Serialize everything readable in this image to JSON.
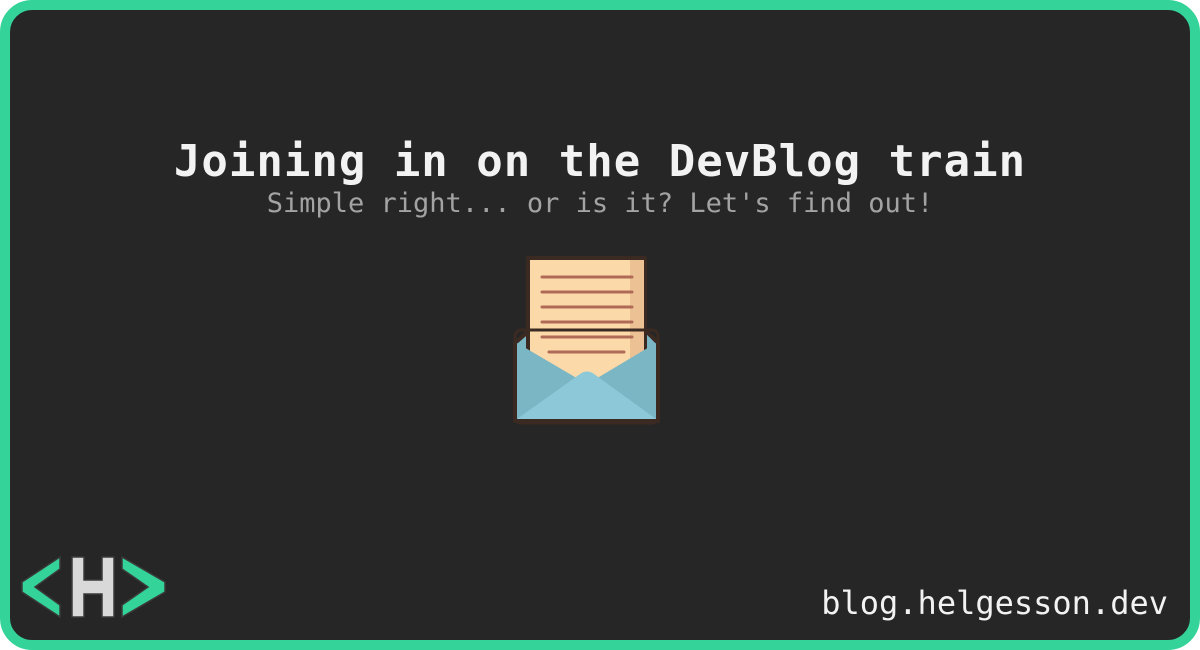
{
  "title": "Joining in on the DevBlog train",
  "subtitle": "Simple right... or is it? Let's find out!",
  "url": "blog.helgesson.dev",
  "logo": {
    "text": "<H>"
  },
  "colors": {
    "accent": "#34d399",
    "background": "#262626",
    "paper": "#fcd9a8",
    "envelope": "#7bb6c4"
  }
}
